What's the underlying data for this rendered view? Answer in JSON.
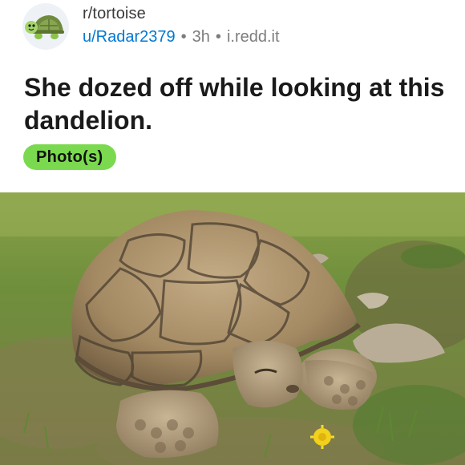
{
  "post": {
    "subreddit": "r/tortoise",
    "username": "u/Radar2379",
    "separator": "•",
    "time_ago": "3h",
    "domain": "i.redd.it",
    "title": "She dozed off while looking at this dandelion.",
    "flair": "Photo(s)"
  },
  "icons": {
    "avatar": "tortoise-avatar-icon"
  },
  "colors": {
    "link_blue": "#0079d3",
    "flair_green": "#7bd94f",
    "meta_gray": "#7c7c7c",
    "title_black": "#1a1a1b"
  }
}
